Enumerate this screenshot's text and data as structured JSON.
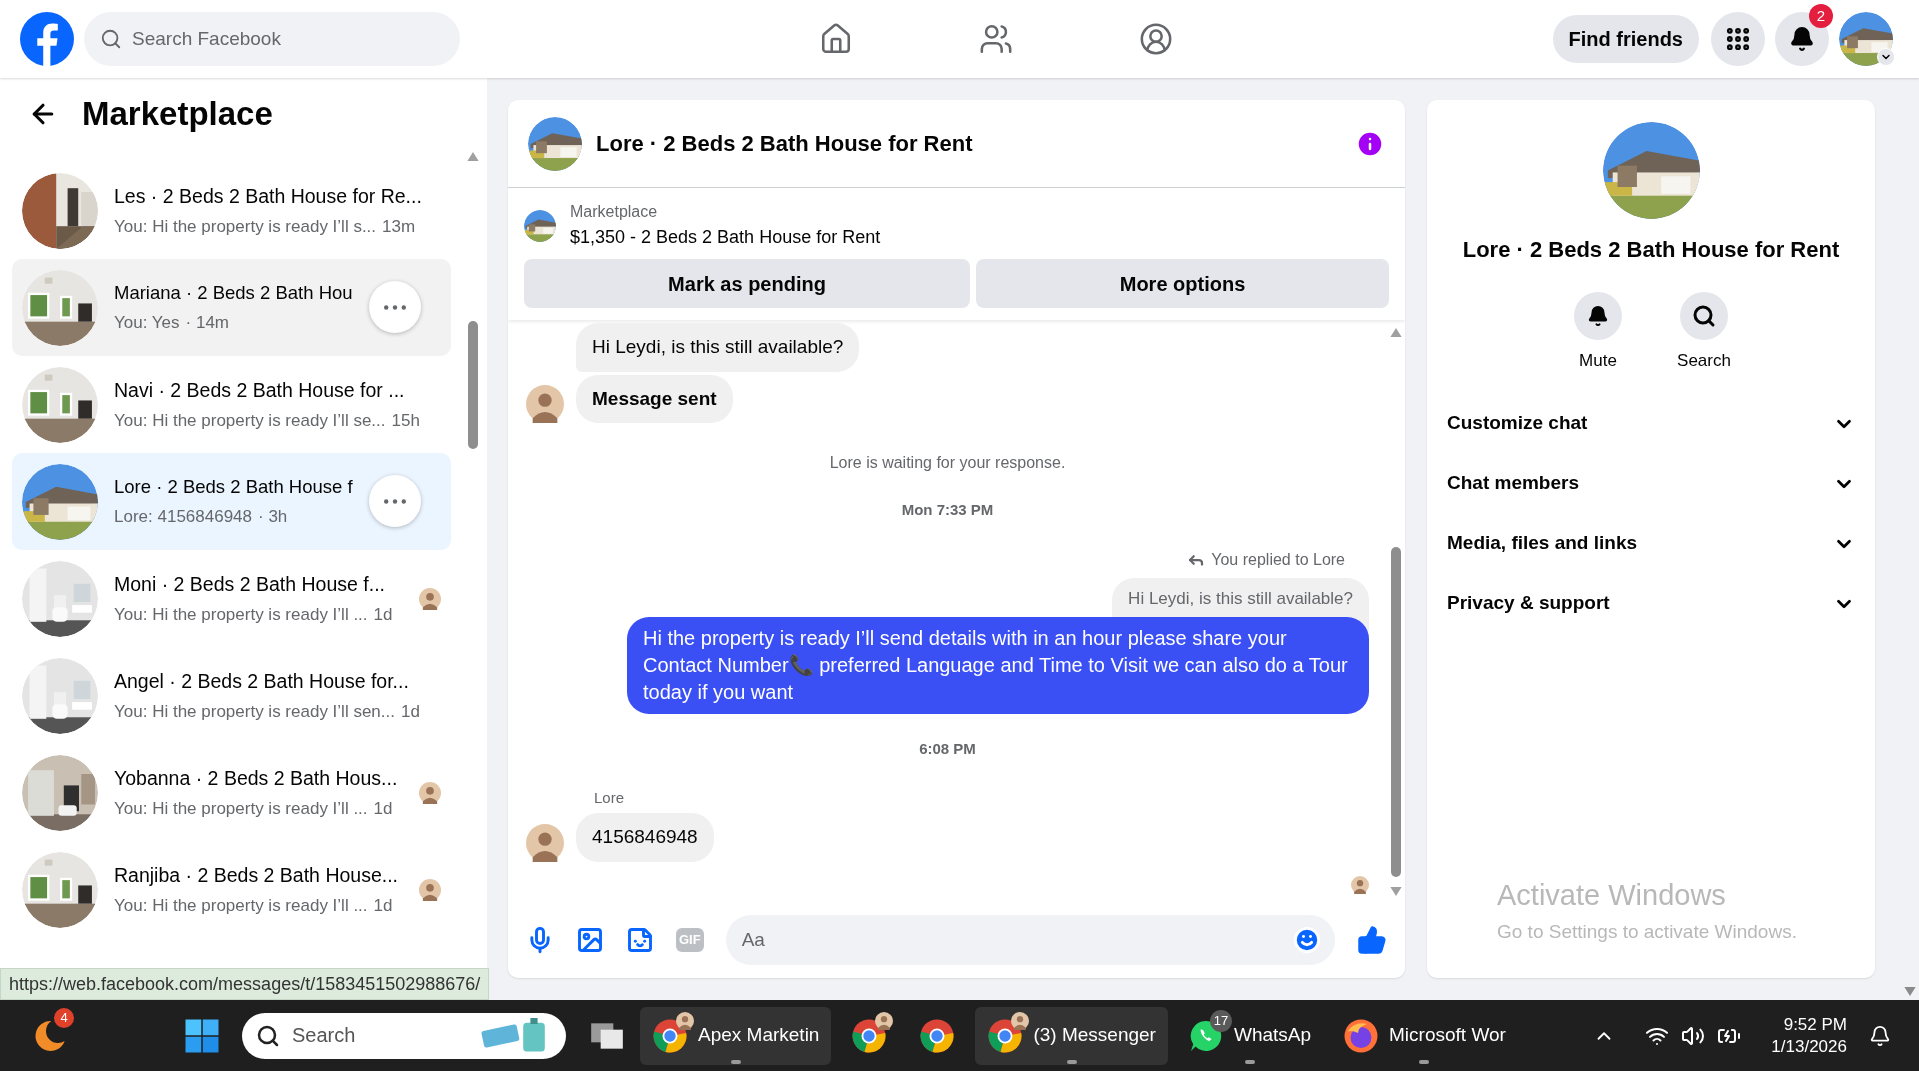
{
  "topbar": {
    "search_placeholder": "Search Facebook",
    "find_friends": "Find friends",
    "notification_count": "2"
  },
  "sidebar": {
    "title": "Marketplace",
    "items": [
      {
        "title": "Les · 2 Beds 2 Bath House for Re...",
        "preview": "You: Hi the property is ready I’ll s...",
        "time": "13m",
        "selected": false,
        "hovered": false,
        "seen": false
      },
      {
        "title": "Mariana · 2 Beds 2 Bath Hou",
        "preview": "You: Yes",
        "time": "· 14m",
        "selected": false,
        "hovered": true,
        "seen": false
      },
      {
        "title": "Navi · 2 Beds 2 Bath House for ...",
        "preview": "You: Hi the property is ready I’ll se...",
        "time": "15h",
        "selected": false,
        "hovered": false,
        "seen": false
      },
      {
        "title": "Lore · 2 Beds 2 Bath House f",
        "preview": "Lore: 4156846948",
        "time": "· 3h",
        "selected": true,
        "hovered": false,
        "seen": false
      },
      {
        "title": "Moni · 2 Beds 2 Bath House f...",
        "preview": "You: Hi the property is ready I’ll ...",
        "time": "1d",
        "selected": false,
        "hovered": false,
        "seen": true
      },
      {
        "title": "Angel · 2 Beds 2 Bath House for...",
        "preview": "You: Hi the property is ready I’ll sen...",
        "time": "1d",
        "selected": false,
        "hovered": false,
        "seen": false
      },
      {
        "title": "Yobanna · 2 Beds 2 Bath Hous...",
        "preview": "You: Hi the property is ready I’ll ...",
        "time": "1d",
        "selected": false,
        "hovered": false,
        "seen": true
      },
      {
        "title": "Ranjiba · 2 Beds 2 Bath House...",
        "preview": "You: Hi the property is ready I’ll ...",
        "time": "1d",
        "selected": false,
        "hovered": false,
        "seen": true
      }
    ]
  },
  "status_url": "https://web.facebook.com/messages/t/1583451502988676/",
  "chat": {
    "title": "Lore · 2 Beds 2 Bath House for Rent",
    "listing_label": "Marketplace",
    "listing": "$1,350 - 2 Beds 2 Bath House for Rent",
    "buttons": [
      "Mark as pending",
      "More options"
    ],
    "messages": [
      {
        "kind": "incoming",
        "text": "Hi Leydi, is this still available?",
        "bold": false,
        "avatar": false
      },
      {
        "kind": "incoming",
        "text": "Message sent",
        "bold": true,
        "avatar": true
      },
      {
        "kind": "notice",
        "text": "Lore is waiting for your response."
      },
      {
        "kind": "timestamp",
        "text": "Mon 7:33 PM"
      },
      {
        "kind": "reply",
        "label": "You replied to Lore",
        "quote": "Hi Leydi, is this still available?",
        "text": "Hi the property is ready I’ll send details with in an hour please share your Contact Number📞 preferred Language and Time to Visit we can also do a Tour today if you want"
      },
      {
        "kind": "timestamp",
        "text": "6:08 PM"
      },
      {
        "kind": "incoming",
        "sender": "Lore",
        "text": "4156846948",
        "bold": false,
        "avatar": true
      }
    ],
    "gif_label": "GIF",
    "composer_placeholder": "Aa"
  },
  "details": {
    "title": "Lore · 2 Beds 2 Bath House for Rent",
    "actions": [
      {
        "kind": "mute",
        "label": "Mute"
      },
      {
        "kind": "search",
        "label": "Search"
      }
    ],
    "sections": [
      {
        "label": "Customize chat",
        "expanded": false
      },
      {
        "label": "Chat members",
        "expanded": false
      },
      {
        "label": "Media, files and links",
        "expanded": false
      },
      {
        "label": "Privacy & support",
        "expanded": false
      }
    ]
  },
  "activation": {
    "title": "Activate Windows",
    "subtitle": "Go to Settings to activate Windows."
  },
  "taskbar": {
    "widget_badge": "4",
    "search_placeholder": "Search",
    "apps": [
      {
        "kind": "chrome",
        "label": "Apex Marketin",
        "highlighted": true,
        "running": true,
        "profile": true
      },
      {
        "kind": "chrome",
        "highlighted": false,
        "running": false,
        "profile": true
      },
      {
        "kind": "chrome",
        "highlighted": false,
        "running": false,
        "profile": false
      },
      {
        "kind": "chrome",
        "label": "(3) Messenger",
        "highlighted": true,
        "running": true,
        "profile": true
      },
      {
        "kind": "whatsapp",
        "label": "WhatsAp",
        "badge": "17",
        "highlighted": false,
        "running": true,
        "profile": false
      },
      {
        "kind": "firefox",
        "label": "Microsoft Wor",
        "highlighted": false,
        "running": true,
        "profile": false
      }
    ],
    "time": "9:52 PM",
    "date": "1/13/2026"
  }
}
